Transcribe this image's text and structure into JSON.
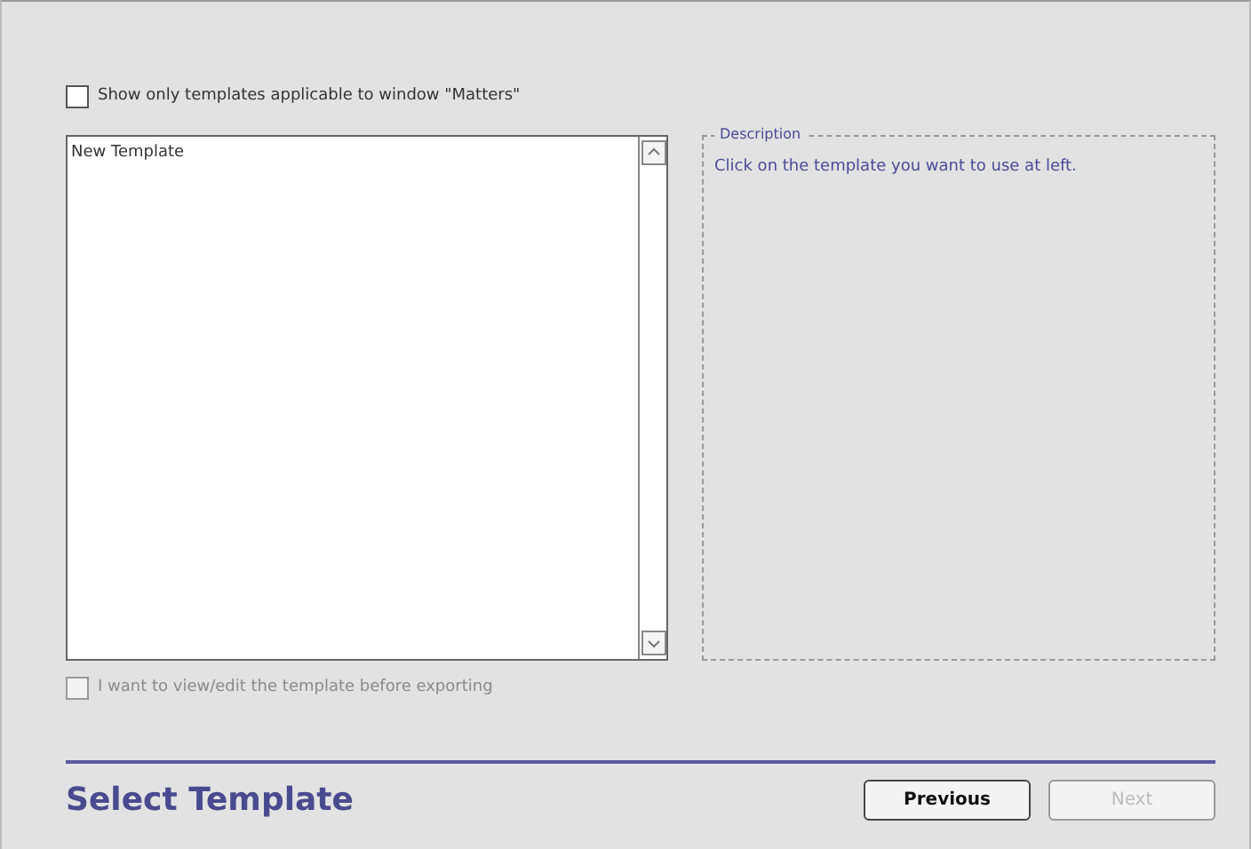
{
  "filter_checkbox": {
    "label": "Show only templates applicable to window \"Matters\"",
    "checked": false,
    "disabled": false
  },
  "template_list": {
    "items": [
      {
        "label": "New Template",
        "selected": false
      }
    ]
  },
  "description": {
    "title": "Description",
    "text": "Click on the template you want to use at left."
  },
  "edit_checkbox": {
    "label": "I want to view/edit the template before exporting",
    "checked": false,
    "disabled": true
  },
  "step_title": "Select Template",
  "buttons": [
    {
      "label": "Previous",
      "disabled": false
    },
    {
      "label": "Next",
      "disabled": true
    }
  ]
}
